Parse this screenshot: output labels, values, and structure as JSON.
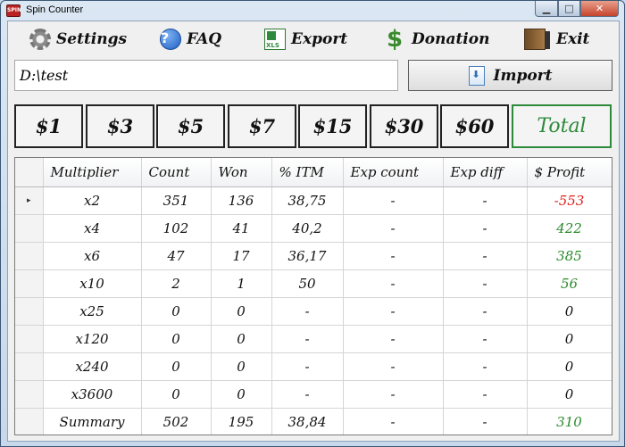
{
  "window": {
    "title": "Spin Counter",
    "icon_text": "SPIN"
  },
  "menu": {
    "settings": "Settings",
    "faq": "FAQ",
    "export": "Export",
    "export_icon_text": "XLS",
    "donation": "Donation",
    "exit": "Exit"
  },
  "path": {
    "value": "D:\\test"
  },
  "import": {
    "label": "Import"
  },
  "stakes": [
    "$1",
    "$3",
    "$5",
    "$7",
    "$15",
    "$30",
    "$60"
  ],
  "total_label": "Total",
  "colors": {
    "negative": "#e0201b",
    "positive": "#2a8a2a",
    "total_border": "#2d8a3a"
  },
  "table": {
    "columns": [
      "Multiplier",
      "Count",
      "Won",
      "% ITM",
      "Exp count",
      "Exp diff",
      "$ Profit"
    ],
    "current_row_marker": "▸",
    "rows": [
      {
        "multiplier": "x2",
        "count": "351",
        "won": "136",
        "itm": "38,75",
        "exp_count": "-",
        "exp_diff": "-",
        "profit": "-553",
        "profit_sign": "neg"
      },
      {
        "multiplier": "x4",
        "count": "102",
        "won": "41",
        "itm": "40,2",
        "exp_count": "-",
        "exp_diff": "-",
        "profit": "422",
        "profit_sign": "pos"
      },
      {
        "multiplier": "x6",
        "count": "47",
        "won": "17",
        "itm": "36,17",
        "exp_count": "-",
        "exp_diff": "-",
        "profit": "385",
        "profit_sign": "pos"
      },
      {
        "multiplier": "x10",
        "count": "2",
        "won": "1",
        "itm": "50",
        "exp_count": "-",
        "exp_diff": "-",
        "profit": "56",
        "profit_sign": "pos"
      },
      {
        "multiplier": "x25",
        "count": "0",
        "won": "0",
        "itm": "-",
        "exp_count": "-",
        "exp_diff": "-",
        "profit": "0",
        "profit_sign": "zero"
      },
      {
        "multiplier": "x120",
        "count": "0",
        "won": "0",
        "itm": "-",
        "exp_count": "-",
        "exp_diff": "-",
        "profit": "0",
        "profit_sign": "zero"
      },
      {
        "multiplier": "x240",
        "count": "0",
        "won": "0",
        "itm": "-",
        "exp_count": "-",
        "exp_diff": "-",
        "profit": "0",
        "profit_sign": "zero"
      },
      {
        "multiplier": "x3600",
        "count": "0",
        "won": "0",
        "itm": "-",
        "exp_count": "-",
        "exp_diff": "-",
        "profit": "0",
        "profit_sign": "zero"
      },
      {
        "multiplier": "Summary",
        "count": "502",
        "won": "195",
        "itm": "38,84",
        "exp_count": "-",
        "exp_diff": "-",
        "profit": "310",
        "profit_sign": "pos"
      }
    ]
  }
}
